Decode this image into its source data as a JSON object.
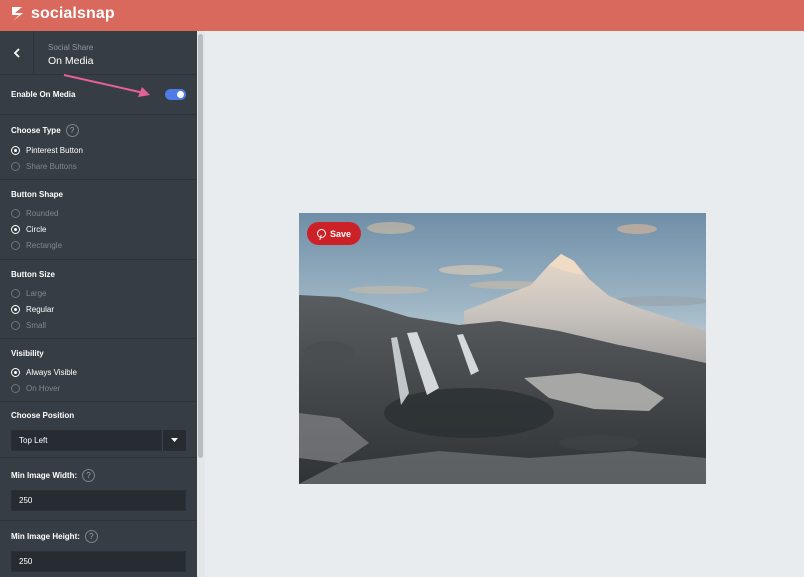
{
  "brand": {
    "name": "socialsnap"
  },
  "panel": {
    "subtitle": "Social Share",
    "title": "On Media"
  },
  "enable": {
    "label": "Enable On Media",
    "on": true
  },
  "choose_type": {
    "label": "Choose Type",
    "help": "?",
    "options": [
      "Pinterest Button",
      "Share Buttons"
    ],
    "selected": "Pinterest Button"
  },
  "button_shape": {
    "label": "Button Shape",
    "options": [
      "Rounded",
      "Circle",
      "Rectangle"
    ],
    "selected": "Circle"
  },
  "button_size": {
    "label": "Button Size",
    "options": [
      "Large",
      "Regular",
      "Small"
    ],
    "selected": "Regular"
  },
  "visibility": {
    "label": "Visibility",
    "options": [
      "Always Visible",
      "On Hover"
    ],
    "selected": "Always Visible"
  },
  "position": {
    "label": "Choose Position",
    "value": "Top Left"
  },
  "min_width": {
    "label": "Min Image Width:",
    "help": "?",
    "value": "250"
  },
  "min_height": {
    "label": "Min Image Height:",
    "help": "?",
    "value": "250"
  },
  "preview": {
    "save_label": "Save"
  },
  "colors": {
    "header": "#d9685d",
    "sidebar": "#373d45",
    "toggle": "#4f7be6",
    "pinterest": "#cc2127",
    "annotation_arrow": "#e5609a"
  }
}
